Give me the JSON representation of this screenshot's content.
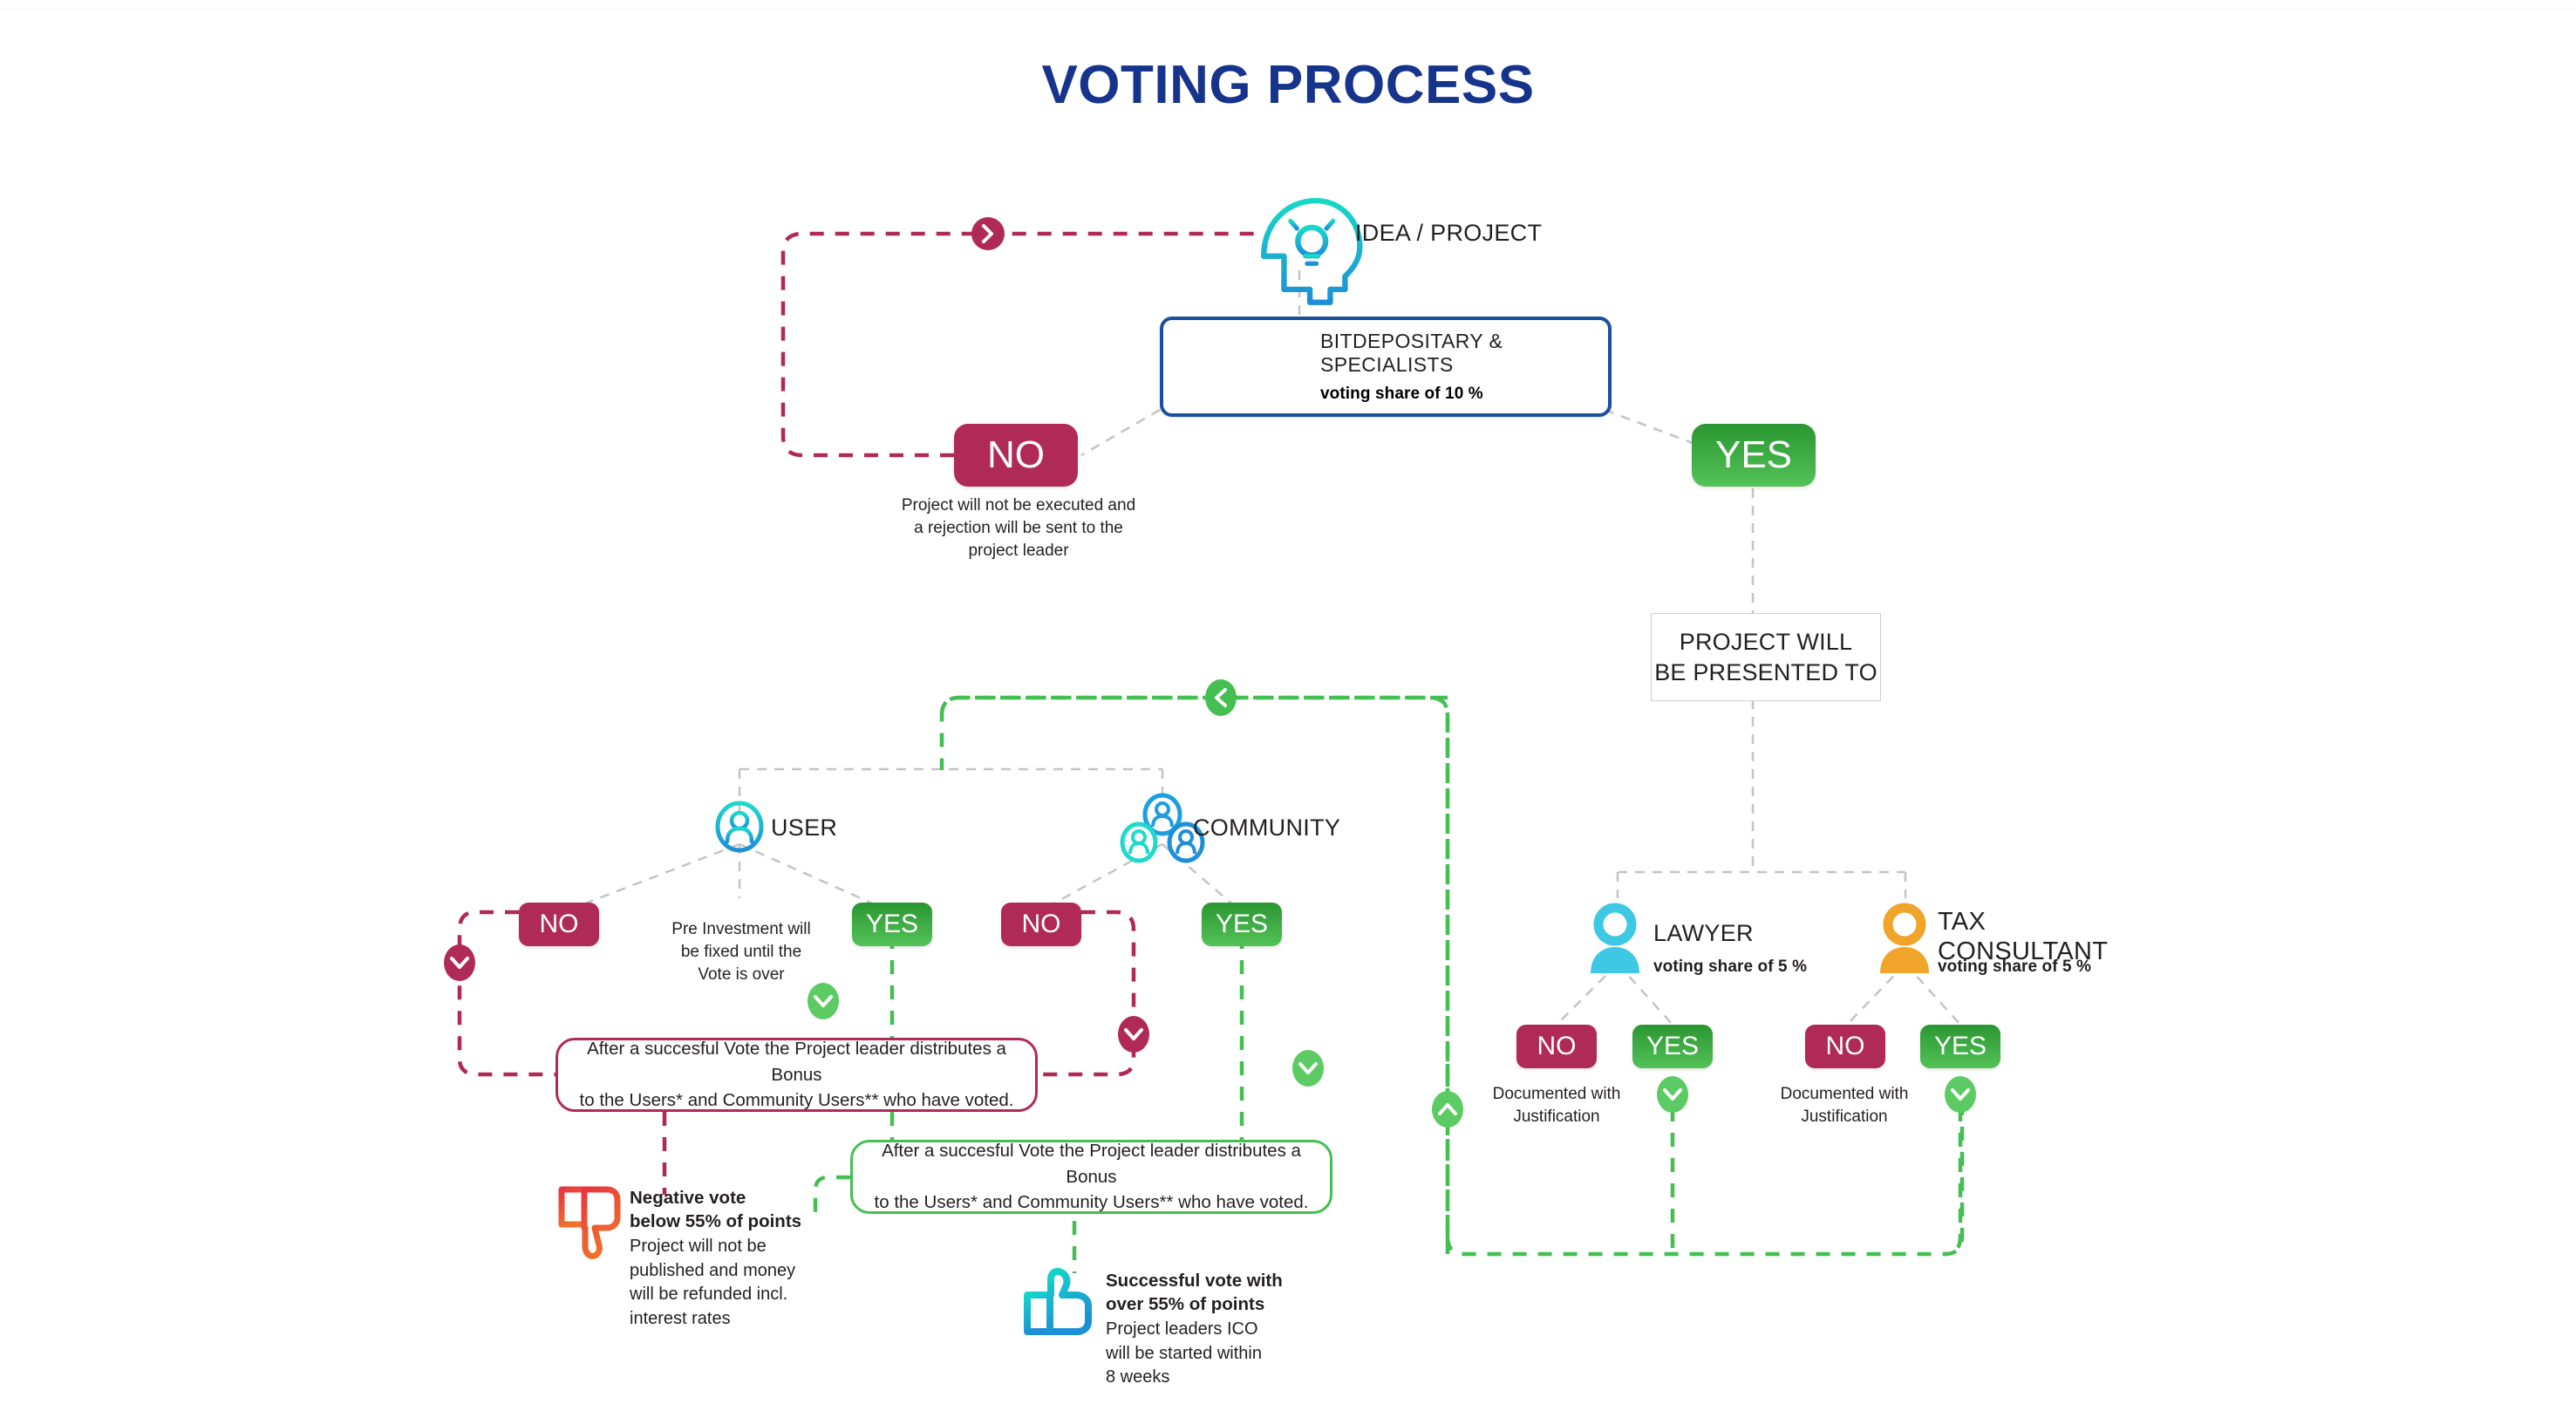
{
  "title": "VOTING PROCESS",
  "colors": {
    "title": "#16348c",
    "no": "#b02a57",
    "yes_top": "#2a9631",
    "yes_bottom": "#53c257",
    "bitbox_border": "#1a4fa0",
    "cyan": "#20c6df",
    "blue": "#1d8fd6",
    "purple": "#6f3d9e",
    "orange": "#f0a42a",
    "gray_wire": "#c4c4c4",
    "green_wire": "#45bf52",
    "pink_wire": "#b02a57",
    "thumbdown_from": "#e8353f",
    "thumbdown_to": "#f0722a",
    "thumbup_from": "#14d6c8",
    "thumbup_to": "#1d8fd6"
  },
  "nodes": {
    "idea": {
      "label": "IDEA / PROJECT",
      "icon": "head-lightbulb-icon"
    },
    "bitdepositary": {
      "title": "BITDEPOSITARY & SPECIALISTS",
      "share": "voting share of 10 %",
      "logo_icon": "bitdepositary-logo-icon",
      "person_icon": "person-purple-icon"
    },
    "top_no": {
      "label": "NO",
      "caption": "Project will not be executed and\na rejection will be sent to the\nproject leader"
    },
    "top_yes": {
      "label": "YES"
    },
    "presented_to": {
      "label": "PROJECT WILL\nBE PRESENTED TO"
    },
    "user": {
      "label": "USER",
      "icon": "user-single-icon"
    },
    "community": {
      "label": "COMMUNITY",
      "icon": "community-group-icon"
    },
    "lawyer": {
      "label": "LAWYER",
      "share": "voting share of 5 %",
      "icon": "person-cyan-icon"
    },
    "tax_consultant": {
      "label": "TAX\nCONSULTANT",
      "share": "voting share of 5 %",
      "icon": "person-orange-icon"
    }
  },
  "votes": {
    "user_no": "NO",
    "user_yes": "YES",
    "community_no": "NO",
    "community_yes": "YES",
    "lawyer_no": "NO",
    "lawyer_yes": "YES",
    "tax_no": "NO",
    "tax_yes": "YES"
  },
  "captions": {
    "pre_investment": "Pre Investment will\nbe fixed until the\nVote is over",
    "lawyer_documented": "Documented with\nJustification",
    "tax_documented": "Documented with\nJustification"
  },
  "callouts": {
    "bonus_pink": "After a succesful Vote the Project leader distributes a Bonus\nto the Users* and Community Users** who have voted.",
    "bonus_green": "After a succesful Vote the Project leader distributes a Bonus\nto the Users* and Community Users** who have voted."
  },
  "notes": {
    "negative": {
      "icon": "thumbs-down-icon",
      "title": "Negative vote\nbelow 55% of points",
      "body": "Project will not be\npublished and money\nwill be refunded incl.\ninterest rates"
    },
    "positive": {
      "icon": "thumbs-up-icon",
      "title": "Successful vote with\nover 55% of points",
      "body": "Project leaders ICO\nwill be started within\n8 weeks"
    }
  },
  "markers": [
    {
      "name": "marker-chevron-right-pink",
      "glyph": "right"
    },
    {
      "name": "marker-chevron-left-green",
      "glyph": "left"
    },
    {
      "name": "marker-chevron-down-pink-left",
      "glyph": "down"
    },
    {
      "name": "marker-chevron-down-pink-right",
      "glyph": "down"
    },
    {
      "name": "marker-chevron-down-green-user",
      "glyph": "down"
    },
    {
      "name": "marker-chevron-down-green-community",
      "glyph": "down"
    },
    {
      "name": "marker-chevron-up-green",
      "glyph": "up"
    },
    {
      "name": "marker-chevron-down-green-lawyer",
      "glyph": "down"
    },
    {
      "name": "marker-chevron-down-green-tax",
      "glyph": "down"
    }
  ]
}
